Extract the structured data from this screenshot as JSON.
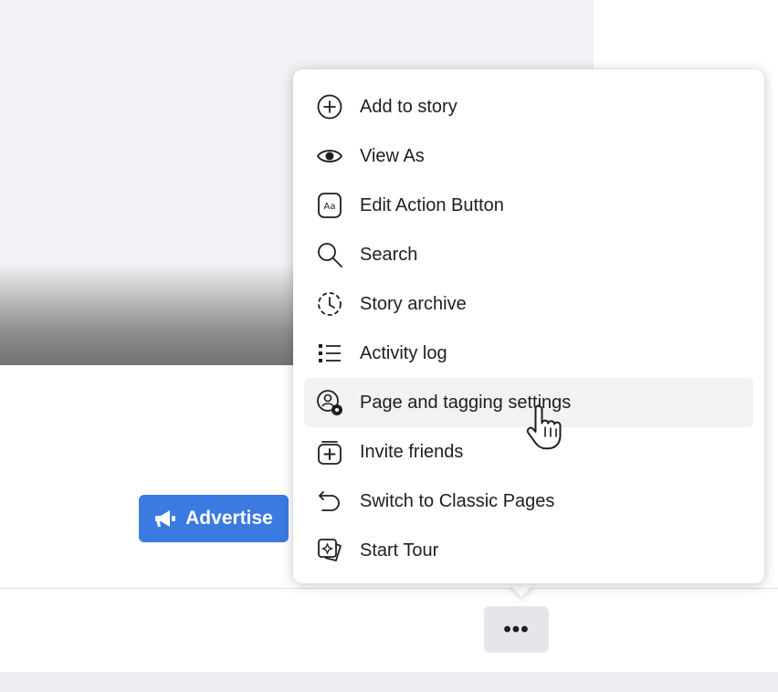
{
  "advertise_button": {
    "label": "Advertise",
    "icon": "megaphone-icon",
    "color": "#3b7ae0"
  },
  "more_button": {
    "label": "•••",
    "icon": "more-icon"
  },
  "menu": {
    "items": [
      {
        "label": "Add to story",
        "icon": "plus-circle-icon"
      },
      {
        "label": "View As",
        "icon": "eye-icon"
      },
      {
        "label": "Edit Action Button",
        "icon": "text-box-icon"
      },
      {
        "label": "Search",
        "icon": "search-icon"
      },
      {
        "label": "Story archive",
        "icon": "clock-history-icon"
      },
      {
        "label": "Activity log",
        "icon": "list-icon"
      },
      {
        "label": "Page and tagging settings",
        "icon": "user-gear-icon",
        "hovered": true
      },
      {
        "label": "Invite friends",
        "icon": "invite-icon"
      },
      {
        "label": "Switch to Classic Pages",
        "icon": "undo-arrow-icon"
      },
      {
        "label": "Start Tour",
        "icon": "tour-cards-icon"
      }
    ]
  }
}
